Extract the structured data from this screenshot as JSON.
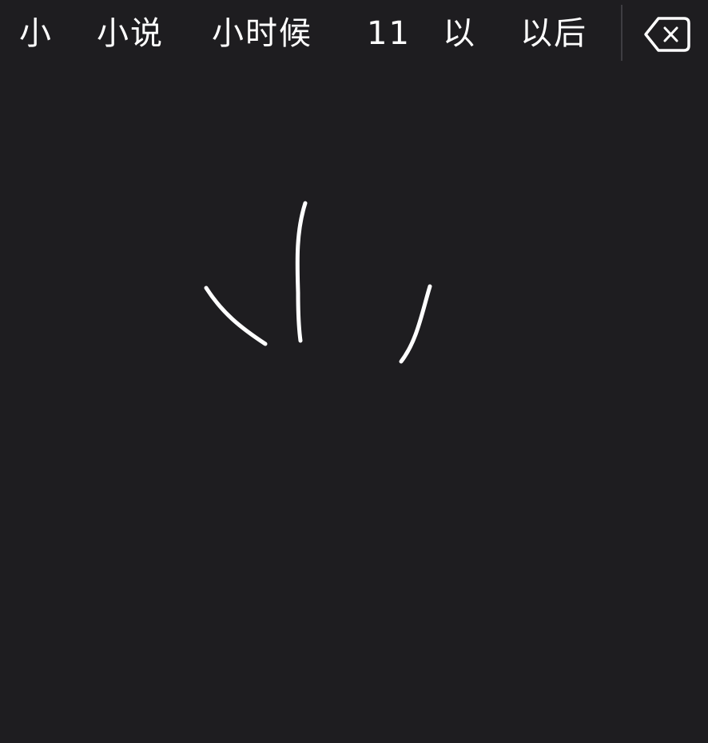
{
  "keyboard": {
    "mode": "handwriting",
    "candidates": [
      "小",
      "小说",
      "小时候",
      "11",
      "以",
      "以后"
    ],
    "delete_icon": "backspace-icon"
  },
  "colors": {
    "background": "#1e1d20",
    "text": "#ffffff",
    "ink": "#ffffff",
    "divider": "#3e3d42"
  }
}
